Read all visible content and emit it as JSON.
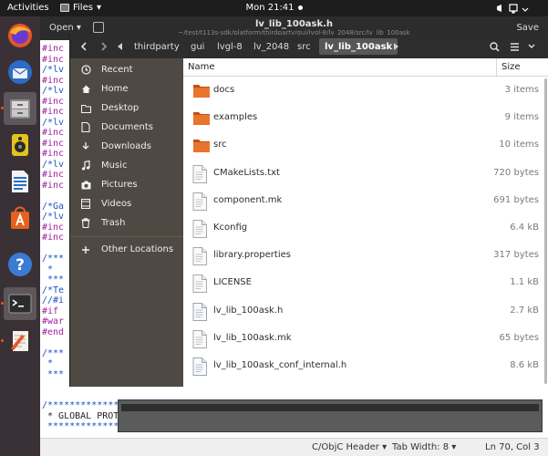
{
  "topbar": {
    "activities": "Activities",
    "app_name": "Files",
    "clock": "Mon 21:41"
  },
  "dock": {
    "items": [
      {
        "name": "firefox",
        "active": false
      },
      {
        "name": "thunderbird",
        "active": false
      },
      {
        "name": "files",
        "active": true
      },
      {
        "name": "rhythmbox",
        "active": false
      },
      {
        "name": "libreoffice-writer",
        "active": false
      },
      {
        "name": "software-center",
        "active": false
      },
      {
        "name": "help",
        "active": false
      },
      {
        "name": "terminal",
        "active": false
      },
      {
        "name": "text-editor",
        "active": false
      }
    ]
  },
  "gedit": {
    "open_label": "Open",
    "title": "lv_lib_100ask.h",
    "subtitle": "~/test/t113s-sdk/platform/thirdparty/gui/lvgl-8/lv_2048/src/lv_lib_100ask",
    "save_label": "Save",
    "code_lines": [
      {
        "text": "#inc",
        "color": "#a020a0"
      },
      {
        "text": "#inc",
        "color": "#a020a0"
      },
      {
        "text": "/*lv",
        "color": "#1a52c4"
      },
      {
        "text": "#inc",
        "color": "#a020a0"
      },
      {
        "text": "/*lv",
        "color": "#1a52c4"
      },
      {
        "text": "#inc",
        "color": "#a020a0"
      },
      {
        "text": "#inc",
        "color": "#a020a0"
      },
      {
        "text": "/*lv",
        "color": "#1a52c4"
      },
      {
        "text": "#inc",
        "color": "#a020a0"
      },
      {
        "text": "#inc",
        "color": "#a020a0"
      },
      {
        "text": "#inc",
        "color": "#a020a0"
      },
      {
        "text": "/*lv",
        "color": "#1a52c4"
      },
      {
        "text": "#inc",
        "color": "#a020a0"
      },
      {
        "text": "#inc",
        "color": "#a020a0"
      },
      {
        "text": "",
        "color": "#222222"
      },
      {
        "text": "/*Ga",
        "color": "#1a52c4"
      },
      {
        "text": "/*lv",
        "color": "#1a52c4"
      },
      {
        "text": "#inc",
        "color": "#a020a0"
      },
      {
        "text": "#inc",
        "color": "#a020a0"
      },
      {
        "text": "",
        "color": "#222222"
      },
      {
        "text": "/***",
        "color": "#1a52c4"
      },
      {
        "text": " *",
        "color": "#1a52c4"
      },
      {
        "text": " ***",
        "color": "#1a52c4"
      },
      {
        "text": "/*Te",
        "color": "#1a52c4"
      },
      {
        "text": "//#i",
        "color": "#1a52c4"
      },
      {
        "text": "#if ",
        "color": "#a020a0"
      },
      {
        "text": "#war",
        "color": "#a020a0"
      },
      {
        "text": "#end",
        "color": "#a020a0"
      },
      {
        "text": "",
        "color": "#222222"
      },
      {
        "text": "/***",
        "color": "#1a52c4"
      },
      {
        "text": " *",
        "color": "#1a52c4"
      },
      {
        "text": " ***",
        "color": "#1a52c4"
      },
      {
        "text": "",
        "color": "#222222"
      },
      {
        "text": "",
        "color": "#222222"
      },
      {
        "text": "/**********************",
        "color": "#1a52c4"
      },
      {
        "text": " * GLOBAL PROTOTYPES",
        "color": "#222222"
      },
      {
        "text": " **********************/",
        "color": "#1a52c4"
      }
    ]
  },
  "statusbar": {
    "language": "C/ObjC Header",
    "tab_width": "Tab Width: 8",
    "position": "Ln 70, Col 3"
  },
  "nautilus": {
    "breadcrumbs": [
      "thirdparty",
      "gui",
      "lvgl-8",
      "lv_2048",
      "src",
      "lv_lib_100ask"
    ],
    "sidebar": [
      {
        "label": "Recent",
        "icon": "clock-icon"
      },
      {
        "label": "Home",
        "icon": "home-icon"
      },
      {
        "label": "Desktop",
        "icon": "folder-icon"
      },
      {
        "label": "Documents",
        "icon": "document-icon"
      },
      {
        "label": "Downloads",
        "icon": "download-icon"
      },
      {
        "label": "Music",
        "icon": "music-icon"
      },
      {
        "label": "Pictures",
        "icon": "camera-icon"
      },
      {
        "label": "Videos",
        "icon": "video-icon"
      },
      {
        "label": "Trash",
        "icon": "trash-icon"
      },
      {
        "label": "Other Locations",
        "icon": "plus-icon"
      }
    ],
    "columns": {
      "name": "Name",
      "size": "Size"
    },
    "files": [
      {
        "name": "docs",
        "size": "3 items",
        "kind": "folder"
      },
      {
        "name": "examples",
        "size": "9 items",
        "kind": "folder"
      },
      {
        "name": "src",
        "size": "10 items",
        "kind": "folder"
      },
      {
        "name": "CMakeLists.txt",
        "size": "720 bytes",
        "kind": "text"
      },
      {
        "name": "component.mk",
        "size": "691 bytes",
        "kind": "text"
      },
      {
        "name": "Kconfig",
        "size": "6.4 kB",
        "kind": "text"
      },
      {
        "name": "library.properties",
        "size": "317 bytes",
        "kind": "text"
      },
      {
        "name": "LICENSE",
        "size": "1.1 kB",
        "kind": "text"
      },
      {
        "name": "lv_lib_100ask.h",
        "size": "2.7 kB",
        "kind": "header"
      },
      {
        "name": "lv_lib_100ask.mk",
        "size": "65 bytes",
        "kind": "text"
      },
      {
        "name": "lv_lib_100ask_conf_internal.h",
        "size": "8.6 kB",
        "kind": "header"
      }
    ]
  }
}
